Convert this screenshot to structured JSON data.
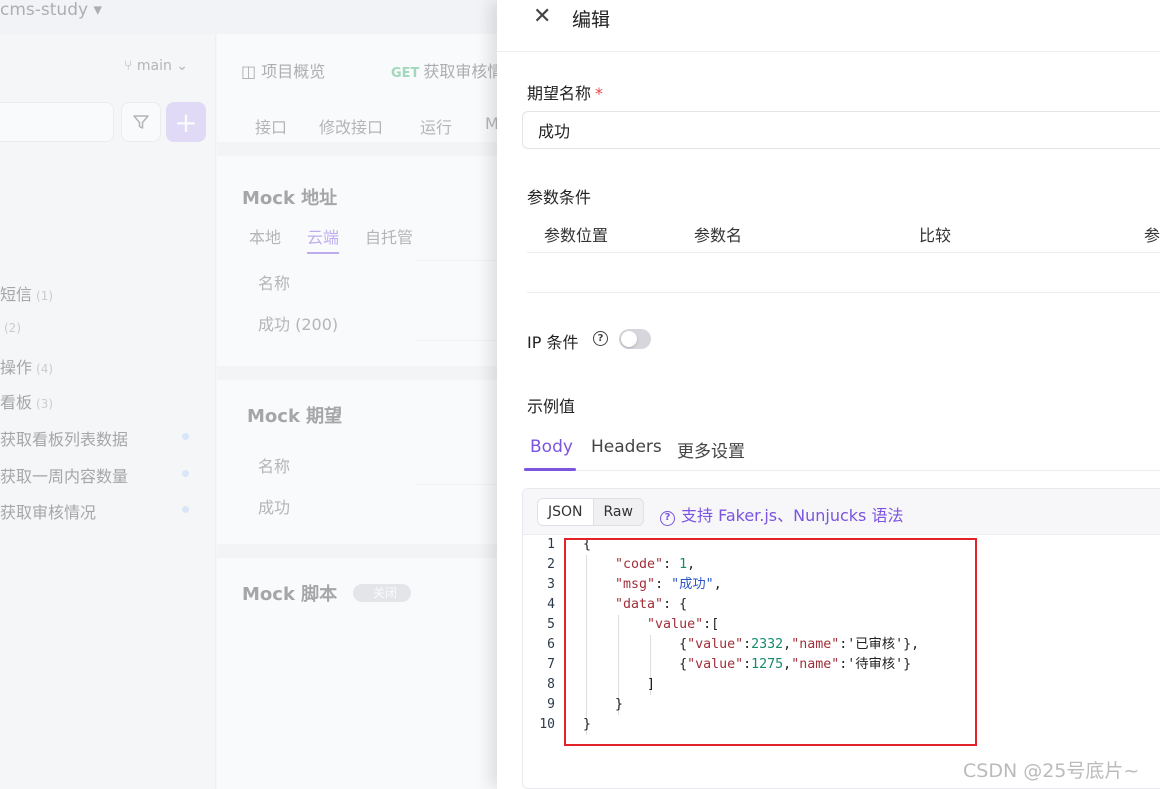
{
  "project": {
    "name": "cms-study ▾"
  },
  "sidebar": {
    "branch": "main",
    "add_label": "+",
    "items": [
      {
        "label": "短信",
        "count": "(1)"
      },
      {
        "label": "",
        "count": "(2)"
      },
      {
        "label": "操作",
        "count": "(4)"
      },
      {
        "label": "看板",
        "count": "(3)"
      },
      {
        "label": "获取看板列表数据",
        "count": ""
      },
      {
        "label": "获取一周内容数量",
        "count": ""
      },
      {
        "label": "获取审核情况",
        "count": ""
      }
    ]
  },
  "background_main": {
    "overview_tab": "项目概览",
    "endpoint_method": "GET",
    "endpoint_name": "获取审核情",
    "subtabs": [
      "接口",
      "修改接口",
      "运行",
      "M"
    ],
    "mock_address": {
      "title": "Mock 地址",
      "tabs": [
        "本地",
        "云端",
        "自托管"
      ],
      "col_name": "名称",
      "row": "成功 (200)"
    },
    "mock_expect": {
      "title": "Mock 期望",
      "col_name": "名称",
      "row": "成功"
    },
    "mock_script": {
      "title": "Mock 脚本",
      "toggle": "关闭"
    }
  },
  "drawer": {
    "title": "编辑",
    "expect_name_label": "期望名称",
    "required_mark": "*",
    "expect_name_value": "成功",
    "param_conditions_label": "参数条件",
    "param_columns": [
      "参数位置",
      "参数名",
      "比较",
      "参"
    ],
    "ip_condition_label": "IP 条件",
    "ip_condition_enabled": false,
    "example_label": "示例值",
    "tabs": [
      "Body",
      "Headers",
      "更多设置"
    ],
    "active_tab": "Body",
    "format_options": [
      "JSON",
      "Raw"
    ],
    "active_format": "JSON",
    "faker_hint": "支持 Faker.js、Nunjucks 语法"
  },
  "code": {
    "line_numbers": [
      "1",
      "2",
      "3",
      "4",
      "5",
      "6",
      "7",
      "8",
      "9",
      "10"
    ],
    "lines": [
      "{",
      "    \"code\": 1,",
      "    \"msg\": \"成功\",",
      "    \"data\": {",
      "        \"value\":[",
      "            {\"value\":2332,\"name\":'已审核'},",
      "            {\"value\":1275,\"name\":'待审核'}",
      "        ]",
      "    }",
      "}"
    ]
  },
  "watermark": "CSDN @25号底片~",
  "colors": {
    "accent": "#7b54e0",
    "highlight_border": "#e2232a",
    "get_method": "#3cb371"
  }
}
